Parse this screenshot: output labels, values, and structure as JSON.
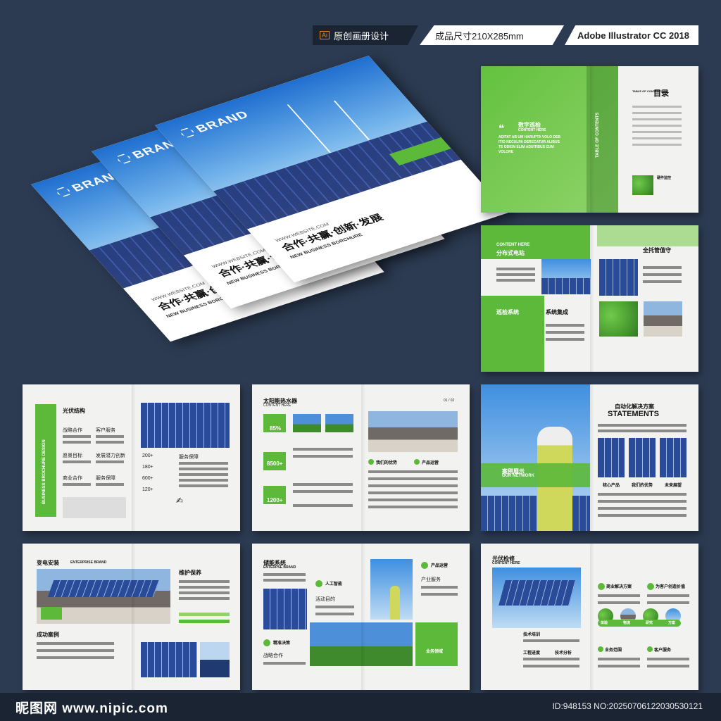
{
  "header": {
    "ai_badge": "Ai",
    "title": "原创画册设计",
    "size": "成品尺寸210X285mm",
    "software": "Adobe Illustrator CC 2018"
  },
  "cover": {
    "brand": "BRAND",
    "website": "WWW.WEBSITE.COM",
    "slogan": "合作·共赢·创新·发展",
    "subtitle": "NEW BUSINESS BORCHURE"
  },
  "spread1": {
    "quote_title": "数字巡检",
    "quote_sub": "CONTENT HERE",
    "quote_body1": "ADITAT AB UM HARUPTA VOLO DEB",
    "quote_body2": "ITIO NECULPA DERECATUR ALIBUS",
    "quote_body3": "TE ODIGN ELIM ADUITIBUS CUM",
    "quote_body4": "VOLORE",
    "toc_label": "TABLE OF CONTENTS",
    "toc_title": "目录",
    "vertical": "TABLE OF CONTENTS",
    "side_label": "硬件监控"
  },
  "spread2": {
    "head_en": "CONTENT HERE",
    "head_cn": "分布式电站",
    "right_title": "全托管值守",
    "box1": "巡检系统",
    "box2": "系统集成"
  },
  "spread3": {
    "title": "光伏结构",
    "vertical": "BUSINESS BROCHURE DESIGN",
    "item1": "战略合作",
    "item2": "客户服务",
    "item3": "愿景目标",
    "item4": "发展潜力创新",
    "item5": "商业合作",
    "item6": "服务保障",
    "n1": "200+",
    "n2": "180+",
    "n3": "600+",
    "n4": "120+",
    "right_label": "服务保障"
  },
  "spread4": {
    "title": "太阳能热水器",
    "sub": "CONTENT HERE",
    "page": "01 / 02",
    "stat1": "85%",
    "stat2": "8500+",
    "stat3": "1200+",
    "tag1": "我们的优势",
    "tag2": "产品运营"
  },
  "spread5": {
    "title_cn": "自动化解决方案",
    "title_en": "STATEMENTS",
    "banner_cn": "案例展示",
    "banner_en": "OUR NETWORK",
    "cap1": "核心产品",
    "cap2": "我们的优势",
    "cap3": "未来展望"
  },
  "spread6": {
    "title": "变电安装",
    "title_en": "ENTERPRISE BRAND",
    "right_title": "维护保养",
    "tag": "成功案例"
  },
  "spread7": {
    "title": "储能系统",
    "title_en": "ENTERPSE BRAND",
    "item1": "人工智能",
    "item2": "活动目的",
    "item3": "精准决策",
    "item4": "战略合作",
    "right1": "产品运营",
    "right2": "产业服务",
    "box": "业务领域"
  },
  "spread8": {
    "title": "光伏检修",
    "sub": "CONTENT HERE",
    "item1": "商业解决方案",
    "item2": "为客户创造价值",
    "item3": "技术培训",
    "item4": "工程进度",
    "item5": "技术分析",
    "item6": "业务范围",
    "item7": "客户服务",
    "c1": "体验",
    "c2": "物流",
    "c3": "研究",
    "c4": "方案"
  },
  "footer": {
    "logo": "昵图网 www.nipic.com",
    "id": "ID:948153 NO:20250706122030530121"
  }
}
